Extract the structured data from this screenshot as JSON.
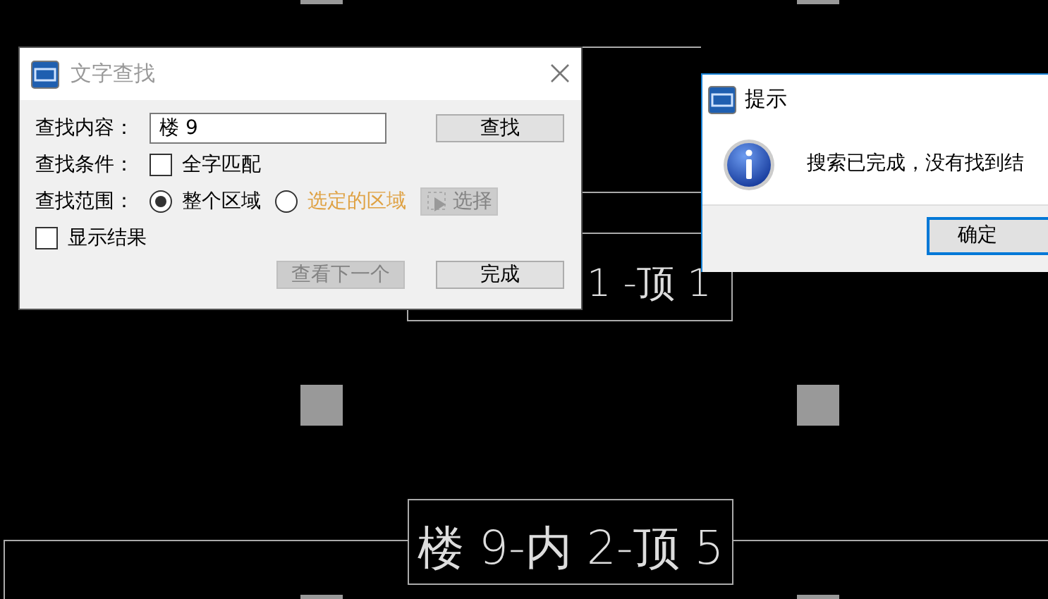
{
  "canvas": {
    "labels": [
      {
        "text": "1 -顶 1"
      },
      {
        "text": "楼 9-内 2-顶 5"
      }
    ]
  },
  "find_dialog": {
    "title": "文字查找",
    "content_label": "查找内容：",
    "content_value": "楼 9",
    "condition_label": "查找条件：",
    "whole_word": {
      "label": "全字匹配",
      "checked": false
    },
    "range_label": "查找范围：",
    "range_options": [
      {
        "label": "整个区域",
        "selected": true,
        "color": "#000000"
      },
      {
        "label": "选定的区域",
        "selected": false,
        "color": "#dfa244"
      }
    ],
    "select_button": {
      "label": "选择",
      "disabled": true
    },
    "show_results": {
      "label": "显示结果",
      "checked": false
    },
    "buttons": [
      {
        "label": "查找",
        "disabled": false
      },
      {
        "label": "查看下一个",
        "disabled": true
      },
      {
        "label": "完成",
        "disabled": false
      }
    ]
  },
  "message_box": {
    "title": "提示",
    "message": "搜索已完成，没有找到结",
    "button": "确定"
  }
}
